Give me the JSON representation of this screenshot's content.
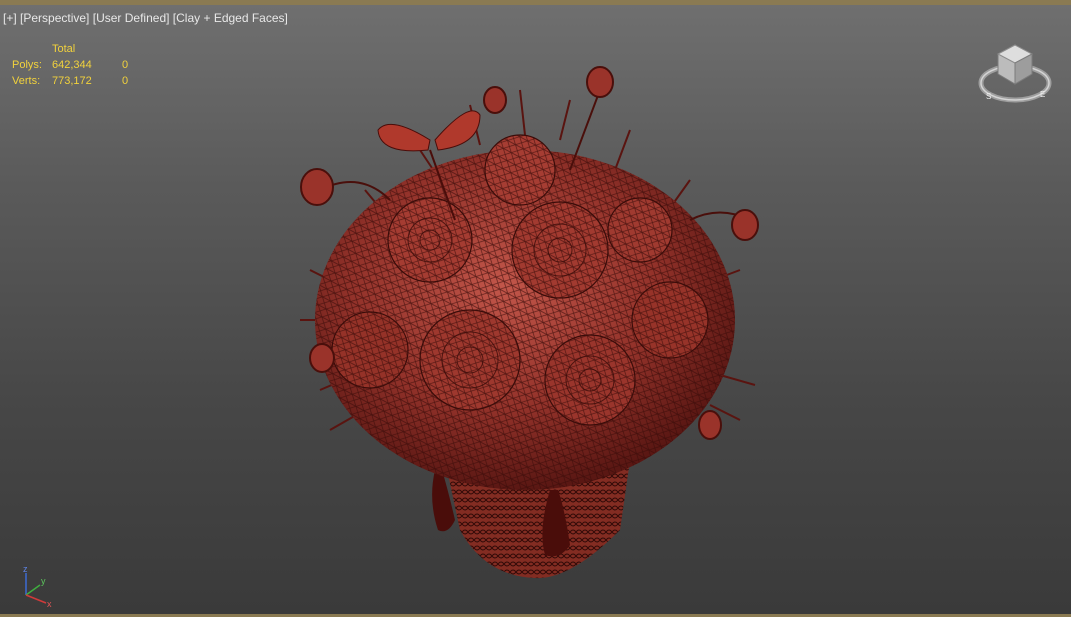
{
  "viewport": {
    "label_plus": "[+]",
    "label_view": "[Perspective]",
    "label_mode": "[User Defined]",
    "label_shading": "[Clay + Edged Faces]"
  },
  "stats": {
    "header": "Total",
    "polys_label": "Polys:",
    "polys_total": "642,344",
    "polys_selected": "0",
    "verts_label": "Verts:",
    "verts_total": "773,172",
    "verts_selected": "0"
  },
  "viewcube": {
    "compass_s": "S",
    "compass_e": "E"
  },
  "axis_gizmo": {
    "z": "z",
    "y": "y",
    "x": "x"
  },
  "colors": {
    "stats_text": "#f2d23c",
    "viewport_border": "#8a7a52",
    "model_base": "#8a2a22",
    "model_wire": "#3a0c09"
  },
  "icons": [
    "viewcube-icon",
    "axis-gizmo-icon"
  ]
}
